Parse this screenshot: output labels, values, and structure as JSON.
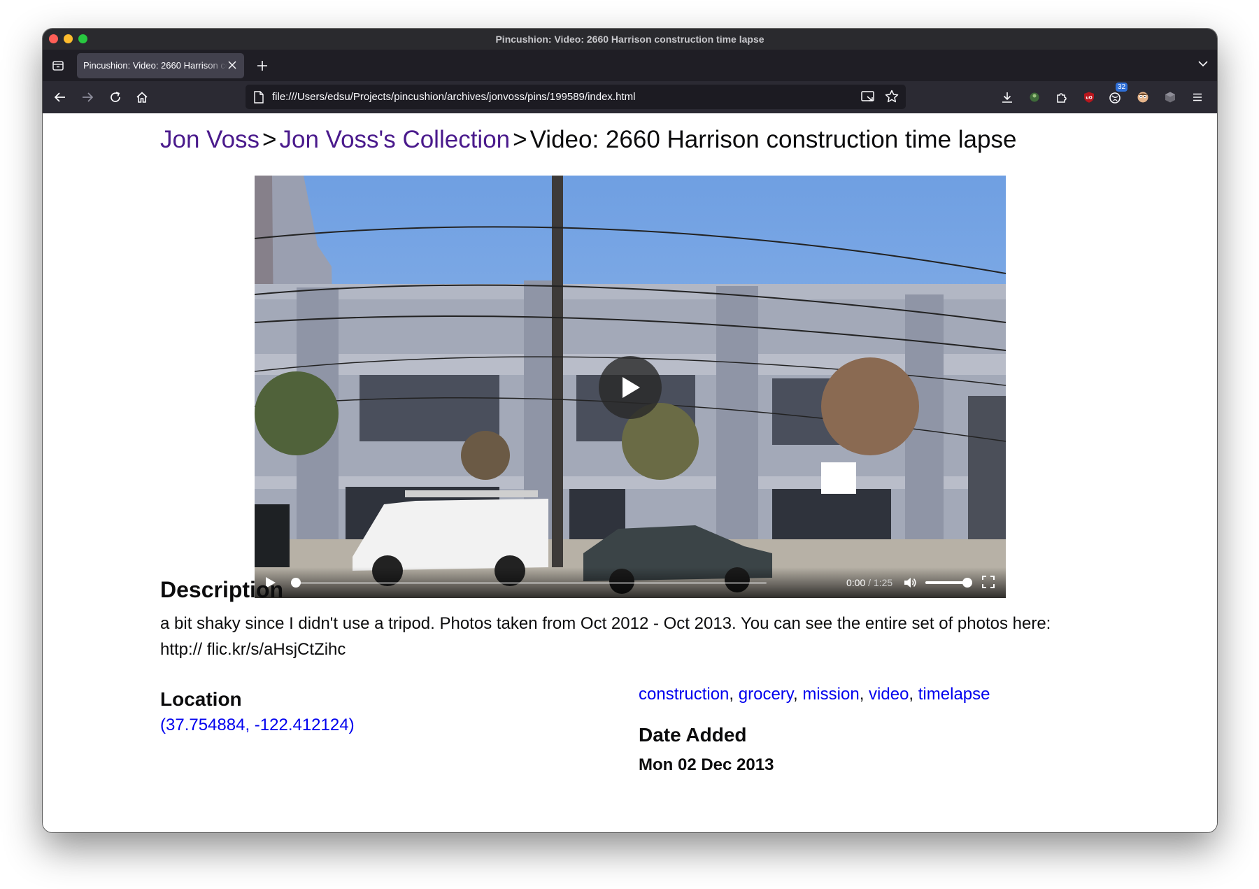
{
  "window": {
    "title": "Pincushion: Video: 2660 Harrison construction time lapse"
  },
  "tab": {
    "title": "Pincushion: Video: 2660 Harrison construction time lapse"
  },
  "toolbar": {
    "url": "file:///Users/edsu/Projects/pincushion/archives/jonvoss/pins/199589/index.html",
    "extension_badge": "32"
  },
  "breadcrumb": {
    "user": "Jon Voss",
    "separator": ">",
    "collection": "Jon Voss's Collection",
    "current": "Video: 2660 Harrison construction time lapse"
  },
  "video": {
    "current_time": "0:00",
    "time_separator": " / ",
    "duration": "1:25",
    "progress": 0,
    "volume": 1.0
  },
  "description": {
    "heading": "Description",
    "text": "a bit shaky since I didn't use a tripod. Photos taken from Oct 2012 - Oct 2013. You can see the entire set of photos here: http:// flic.kr/s/aHsjCtZihc"
  },
  "location": {
    "heading": "Location",
    "coords": "(37.754884, -122.412124)"
  },
  "tags": [
    "construction",
    "grocery",
    "mission",
    "video",
    "timelapse"
  ],
  "date_added": {
    "heading": "Date Added",
    "value": "Mon 02 Dec 2013"
  },
  "colors": {
    "visited_link": "#4a1a8c",
    "link": "#0000ee",
    "chrome_dark": "#1f1e25"
  }
}
